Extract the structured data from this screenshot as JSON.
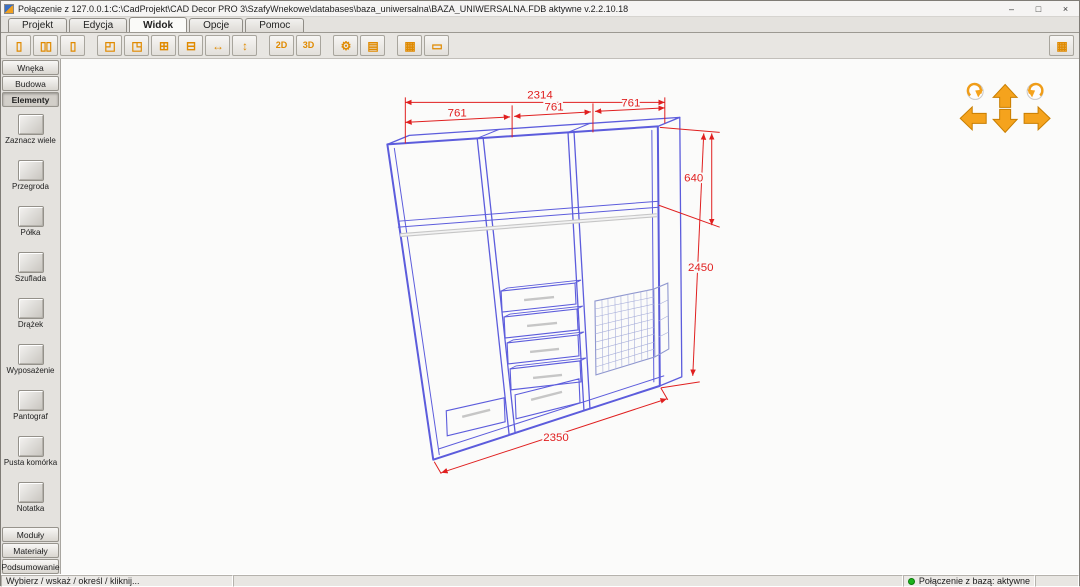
{
  "window": {
    "title": "Połączenie z 127.0.0.1:C:\\CadProjekt\\CAD Decor PRO 3\\SzafyWnekowe\\databases\\baza_uniwersalna\\BAZA_UNIWERSALNA.FDB aktywne  v.2.2.10.18",
    "minimize": "–",
    "maximize": "□",
    "close": "×"
  },
  "tabs": [
    {
      "label": "Projekt"
    },
    {
      "label": "Edycja"
    },
    {
      "label": "Widok"
    },
    {
      "label": "Opcje"
    },
    {
      "label": "Pomoc"
    }
  ],
  "toolbar": {
    "groups": [
      {
        "buttons": [
          {
            "name": "view-niche-button",
            "glyph": "▯"
          },
          {
            "name": "view-body-button",
            "glyph": "▯▯"
          },
          {
            "name": "view-doors-button",
            "glyph": "▯"
          }
        ]
      },
      {
        "buttons": [
          {
            "name": "zoom-fit-button",
            "glyph": "◰"
          },
          {
            "name": "zoom-window-button",
            "glyph": "◳"
          },
          {
            "name": "zoom-in-button",
            "glyph": "⊞"
          },
          {
            "name": "zoom-out-button",
            "glyph": "⊟"
          },
          {
            "name": "pan-horizontal-button",
            "glyph": "↔"
          },
          {
            "name": "pan-vertical-button",
            "glyph": "↕"
          }
        ]
      },
      {
        "buttons": [
          {
            "name": "view-2d-button",
            "glyph": "2D"
          },
          {
            "name": "view-3d-button",
            "glyph": "3D"
          }
        ]
      },
      {
        "buttons": [
          {
            "name": "settings-button",
            "glyph": "⚙"
          },
          {
            "name": "render-button",
            "glyph": "▤"
          }
        ]
      },
      {
        "buttons": [
          {
            "name": "modules-button",
            "glyph": "▦"
          },
          {
            "name": "preview-button",
            "glyph": "▭"
          }
        ]
      }
    ],
    "pricing_button": {
      "name": "pricing-button",
      "glyph": "▦"
    }
  },
  "sidebar": {
    "sections_top": [
      {
        "label": "Wnęka"
      },
      {
        "label": "Budowa"
      },
      {
        "label": "Elementy"
      }
    ],
    "items": [
      {
        "label": "Zaznacz wiele"
      },
      {
        "label": "Przegroda"
      },
      {
        "label": "Półka"
      },
      {
        "label": "Szuflada"
      },
      {
        "label": "Drążek"
      },
      {
        "label": "Wyposażenie"
      },
      {
        "label": "Pantograf"
      },
      {
        "label": "Pusta komórka"
      },
      {
        "label": "Notatka"
      }
    ],
    "sections_bottom": [
      {
        "label": "Moduły"
      },
      {
        "label": "Materiały"
      },
      {
        "label": "Podsumowanie"
      }
    ]
  },
  "canvas": {
    "dims": {
      "total_width": "2314",
      "section_widths": [
        "761",
        "761",
        "761"
      ],
      "upper_height": "640",
      "total_height": "2450",
      "bottom_width": "2350"
    }
  },
  "statusbar": {
    "hint": "Wybierz / wskaż / określ / kliknij...",
    "connection_label": "Połączenie z bazą: aktywne"
  }
}
